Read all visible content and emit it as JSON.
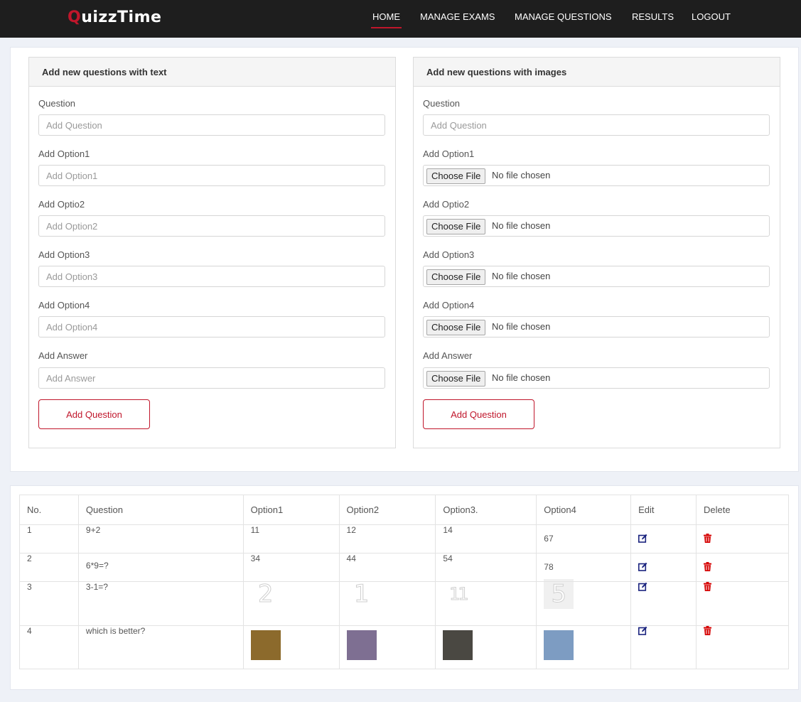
{
  "brand": {
    "first_letter": "Q",
    "rest": "uizzTime"
  },
  "nav": [
    "HOME",
    "MANAGE EXAMS",
    "MANAGE QUESTIONS",
    "RESULTS",
    "LOGOUT"
  ],
  "text_form": {
    "title": "Add new questions with text",
    "fields": [
      {
        "label": "Question",
        "placeholder": "Add Question"
      },
      {
        "label": "Add Option1",
        "placeholder": "Add Option1"
      },
      {
        "label": "Add Optio2",
        "placeholder": "Add Option2"
      },
      {
        "label": "Add Option3",
        "placeholder": "Add Option3"
      },
      {
        "label": "Add Option4",
        "placeholder": "Add Option4"
      },
      {
        "label": "Add Answer",
        "placeholder": "Add Answer"
      }
    ],
    "submit": "Add Question"
  },
  "image_form": {
    "title": "Add new questions with images",
    "question_label": "Question",
    "question_placeholder": "Add Question",
    "file_fields": [
      "Add Option1",
      "Add Optio2",
      "Add Option3",
      "Add Option4",
      "Add Answer"
    ],
    "choose_label": "Choose File",
    "no_file": "No file chosen",
    "submit": "Add Question"
  },
  "table": {
    "headers": [
      "No.",
      "Question",
      "Option1",
      "Option2",
      "Option3.",
      "Option4",
      "Edit",
      "Delete"
    ],
    "rows": [
      {
        "no": "1",
        "question": "9+2",
        "options": [
          "11",
          "12",
          "14",
          "67"
        ]
      },
      {
        "no": "2",
        "question": "6*9=?",
        "options": [
          "34",
          "44",
          "54",
          "78"
        ]
      },
      {
        "no": "3",
        "question": "3-1=?",
        "image_numbers": [
          "2",
          "1",
          "11",
          "5"
        ]
      },
      {
        "no": "4",
        "question": "which is better?",
        "image_colors": [
          "#8c6a2c",
          "#7e6f92",
          "#4a4842",
          "#7d9cc2"
        ]
      }
    ]
  },
  "colors": {
    "accent": "#c0162b",
    "navbar": "#1e1e1e",
    "edit_icon": "#1a237e",
    "delete_icon": "#d50000"
  },
  "icons": {
    "edit": "edit-icon",
    "delete": "trash-icon"
  }
}
